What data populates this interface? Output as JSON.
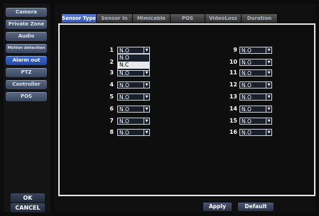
{
  "menu": {
    "items": [
      {
        "label": "Camera"
      },
      {
        "label": "Private Zone"
      },
      {
        "label": "Audio"
      },
      {
        "label": "Motion detection"
      },
      {
        "label": "Alarm out"
      },
      {
        "label": "PTZ"
      },
      {
        "label": "Controller"
      },
      {
        "label": "POS"
      }
    ],
    "active_index": 4,
    "ok_label": "OK",
    "cancel_label": "CANCEL"
  },
  "tabs": [
    {
      "label": "Sensor Type",
      "active": true
    },
    {
      "label": "Sensor In"
    },
    {
      "label": "Mimicable"
    },
    {
      "label": "POS"
    },
    {
      "label": "VideoLoss"
    },
    {
      "label": "Duration"
    }
  ],
  "sensors_left": [
    {
      "num": "1",
      "value": "N.O"
    },
    {
      "num": "2",
      "value": "N.C"
    },
    {
      "num": "3",
      "value": "N.O"
    },
    {
      "num": "4",
      "value": "N.O"
    },
    {
      "num": "5",
      "value": "N.O"
    },
    {
      "num": "6",
      "value": "N.O"
    },
    {
      "num": "7",
      "value": "N.O"
    },
    {
      "num": "8",
      "value": "N.O"
    }
  ],
  "sensors_right": [
    {
      "num": "9",
      "value": "N.O"
    },
    {
      "num": "10",
      "value": "N.O"
    },
    {
      "num": "11",
      "value": "N.O"
    },
    {
      "num": "12",
      "value": "N.O"
    },
    {
      "num": "13",
      "value": "N.O"
    },
    {
      "num": "14",
      "value": "N.O"
    },
    {
      "num": "15",
      "value": "N.O"
    },
    {
      "num": "16",
      "value": "N.O"
    }
  ],
  "dropdown": {
    "options": [
      "N.O",
      "N.C"
    ],
    "highlighted": 1
  },
  "footer": {
    "apply_label": "Apply",
    "default_label": "Default"
  }
}
